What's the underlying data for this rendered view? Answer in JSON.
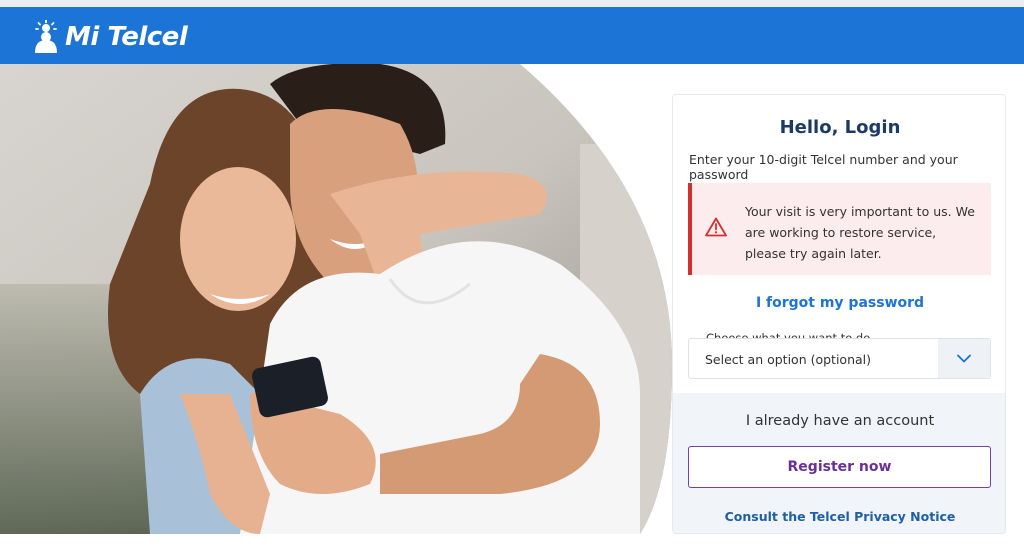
{
  "brand": {
    "name": "Mi Telcel",
    "color": "#1b74d6"
  },
  "login": {
    "title": "Hello, Login",
    "subtitle": "Enter your 10-digit Telcel number and your password",
    "alert": {
      "icon": "warning-triangle-icon",
      "color": "#d32f2f",
      "message": "Your visit is very important to us. We are working to restore service, please try again later."
    },
    "forgot_password": "I forgot my password",
    "select": {
      "label": "Choose what you want to do",
      "value": "Select an option (optional)",
      "icon": "chevron-down-icon"
    },
    "already_account": "I already have an account",
    "register_label": "Register now",
    "privacy_link": "Consult the Telcel Privacy Notice"
  }
}
